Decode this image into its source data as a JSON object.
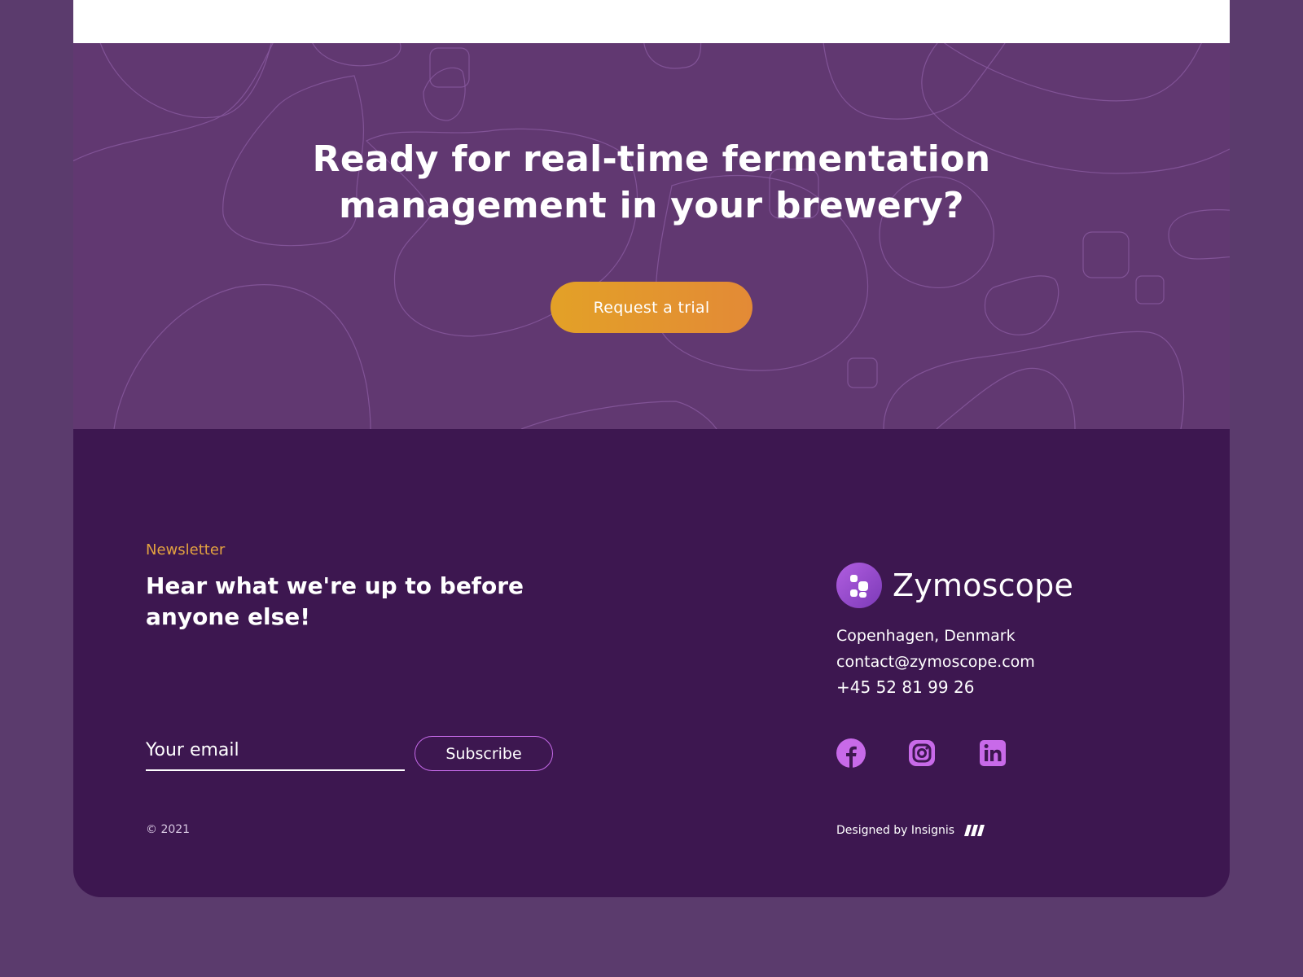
{
  "cta": {
    "title": "Ready for real-time fermentation management in your brewery?",
    "button_label": "Request a trial"
  },
  "newsletter": {
    "label": "Newsletter",
    "title": "Hear what we're up to before anyone else!",
    "email_placeholder": "Your email",
    "subscribe_label": "Subscribe"
  },
  "brand": {
    "name": "Zymoscope",
    "city": "Copenhagen, Denmark",
    "email": "contact@zymoscope.com",
    "phone": "+45 52 81 99 26"
  },
  "social": [
    {
      "icon": "facebook-icon"
    },
    {
      "icon": "instagram-icon"
    },
    {
      "icon": "linkedin-icon"
    }
  ],
  "footer": {
    "copyright": "© 2021",
    "designed_by": "Designed by Insignis"
  },
  "colors": {
    "background": "#5b3b6d",
    "cta_background": "#613871",
    "footer_background": "#3d1750",
    "accent_orange": "#e3a127",
    "accent_purple": "#c56ae8"
  }
}
